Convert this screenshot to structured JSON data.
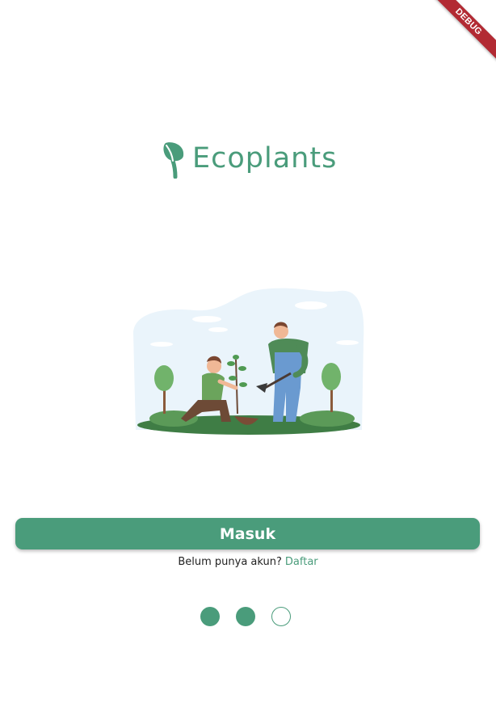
{
  "debug_banner": {
    "label": "DEBUG"
  },
  "logo": {
    "text": "Ecoplants",
    "color": "#4a9c7b"
  },
  "illustration": {
    "description_icon": "planting-trees-illustration"
  },
  "actions": {
    "login_label": "Masuk",
    "signup_prompt": "Belum punya akun?",
    "signup_link": "Daftar"
  },
  "pagination": {
    "dots": [
      "filled",
      "filled",
      "empty"
    ]
  },
  "colors": {
    "accent": "#4a9c7b",
    "debug": "#b22a33"
  }
}
